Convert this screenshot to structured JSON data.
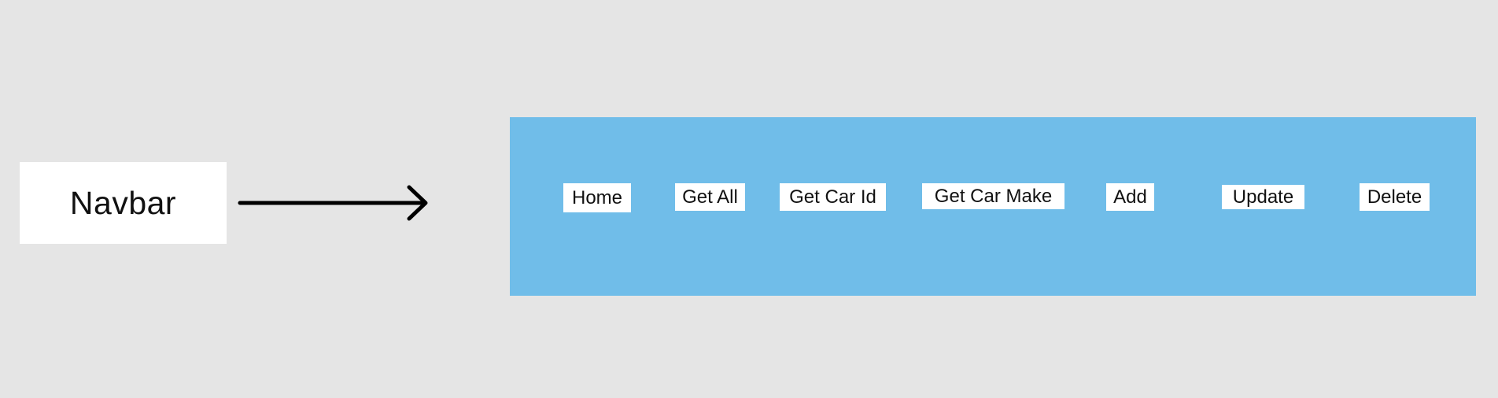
{
  "diagram": {
    "component_label": "Navbar",
    "navbar_color": "#70bde9",
    "nav_items": [
      {
        "label": "Home"
      },
      {
        "label": "Get All"
      },
      {
        "label": "Get Car Id"
      },
      {
        "label": "Get Car Make"
      },
      {
        "label": "Add"
      },
      {
        "label": "Update"
      },
      {
        "label": "Delete"
      }
    ]
  }
}
